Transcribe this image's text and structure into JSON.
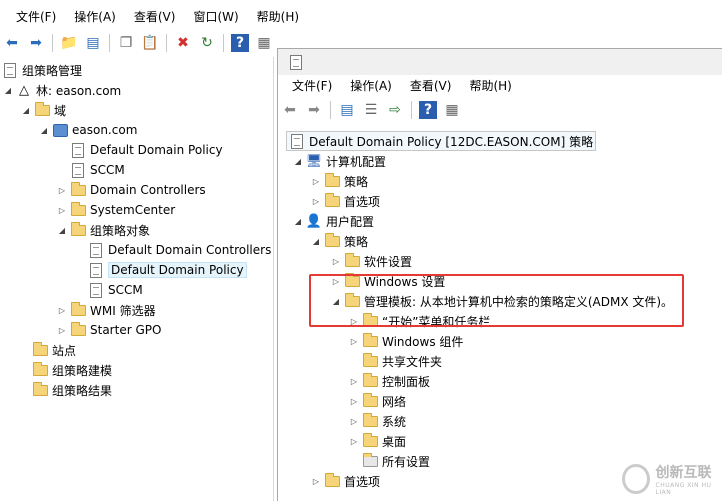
{
  "outer_menu": [
    "文件(F)",
    "操作(A)",
    "查看(V)",
    "窗口(W)",
    "帮助(H)"
  ],
  "inner_menu": [
    "文件(F)",
    "操作(A)",
    "查看(V)",
    "帮助(H)"
  ],
  "left_tree": [
    {
      "label": "组策略管理",
      "icon": "gpm-icon"
    },
    {
      "label": "林: eason.com",
      "icon": "forest-icon"
    },
    {
      "label": "域",
      "icon": "domains-folder-icon"
    },
    {
      "label": "eason.com",
      "icon": "domain-icon"
    },
    {
      "label": "Default Domain Policy",
      "icon": "gpo-link-icon"
    },
    {
      "label": "SCCM",
      "icon": "gpo-link-icon"
    },
    {
      "label": "Domain Controllers",
      "icon": "ou-icon"
    },
    {
      "label": "SystemCenter",
      "icon": "ou-icon"
    },
    {
      "label": "组策略对象",
      "icon": "gpo-folder-icon"
    },
    {
      "label": "Default Domain Controllers",
      "icon": "gpo-icon"
    },
    {
      "label": "Default Domain Policy",
      "icon": "gpo-icon"
    },
    {
      "label": "SCCM",
      "icon": "gpo-icon"
    },
    {
      "label": "WMI 筛选器",
      "icon": "wmi-folder-icon"
    },
    {
      "label": "Starter GPO",
      "icon": "starter-gpo-folder-icon"
    },
    {
      "label": "站点",
      "icon": "sites-icon"
    },
    {
      "label": "组策略建模",
      "icon": "modeling-icon"
    },
    {
      "label": "组策略结果",
      "icon": "results-icon"
    }
  ],
  "right_tree": [
    {
      "label": "Default Domain Policy [12DC.EASON.COM] 策略",
      "icon": "policy-doc-icon"
    },
    {
      "label": "计算机配置",
      "icon": "computer-icon"
    },
    {
      "label": "策略",
      "icon": "folder-icon"
    },
    {
      "label": "首选项",
      "icon": "folder-icon"
    },
    {
      "label": "用户配置",
      "icon": "user-icon"
    },
    {
      "label": "策略",
      "icon": "folder-icon"
    },
    {
      "label": "软件设置",
      "icon": "folder-icon"
    },
    {
      "label": "Windows 设置",
      "icon": "folder-icon"
    },
    {
      "label": "管理模板: 从本地计算机中检索的策略定义(ADMX 文件)。",
      "icon": "folder-icon"
    },
    {
      "label": "“开始”菜单和任务栏",
      "icon": "folder-icon"
    },
    {
      "label": "Windows 组件",
      "icon": "folder-icon"
    },
    {
      "label": "共享文件夹",
      "icon": "folder-icon"
    },
    {
      "label": "控制面板",
      "icon": "folder-icon"
    },
    {
      "label": "网络",
      "icon": "folder-icon"
    },
    {
      "label": "系统",
      "icon": "folder-icon"
    },
    {
      "label": "桌面",
      "icon": "folder-icon"
    },
    {
      "label": "所有设置",
      "icon": "all-settings-icon"
    },
    {
      "label": "首选项",
      "icon": "folder-icon"
    }
  ],
  "watermark": {
    "title": "创新互联",
    "subtitle": "CHUANG XIN HU LIAN"
  }
}
